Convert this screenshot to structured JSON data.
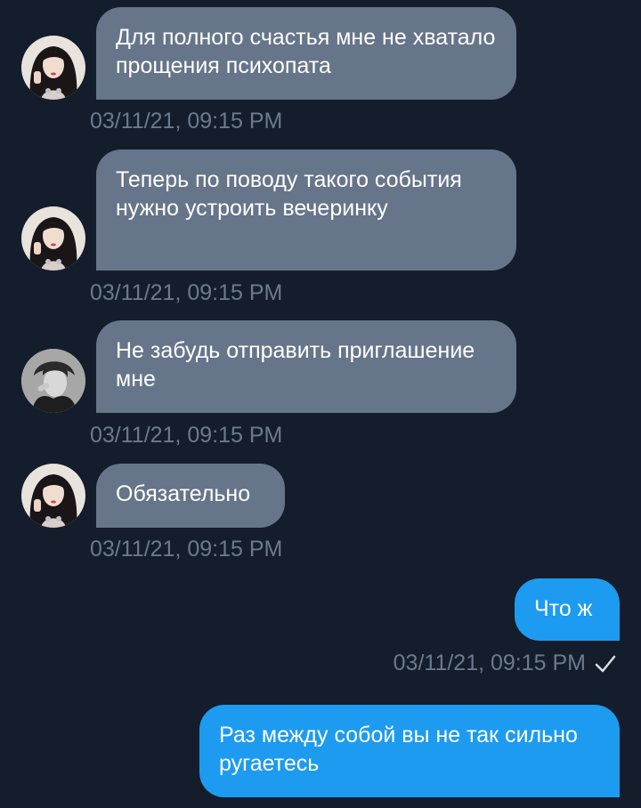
{
  "messages": [
    {
      "direction": "incoming",
      "avatar": "avatar-girl",
      "text": "Для полного счастья мне не хватало прощения психопата",
      "timestamp": "03/11/21, 09:15 PM"
    },
    {
      "direction": "incoming",
      "avatar": "avatar-girl",
      "text": "Теперь по поводу такого события нужно устроить вечеринку",
      "timestamp": "03/11/21, 09:15 PM"
    },
    {
      "direction": "incoming",
      "avatar": "avatar-guy",
      "text": "Не забудь отправить приглашение мне",
      "timestamp": "03/11/21, 09:15 PM"
    },
    {
      "direction": "incoming",
      "avatar": "avatar-girl",
      "text": "Обязательно",
      "timestamp": "03/11/21, 09:15 PM"
    },
    {
      "direction": "outgoing",
      "text": "Что ж",
      "timestamp": "03/11/21, 09:15 PM",
      "status_icon": "check-icon"
    },
    {
      "direction": "outgoing",
      "text": "Раз между собой вы не так сильно ругаетесь"
    }
  ],
  "colors": {
    "background": "#141D2B",
    "incoming_bubble": "#66758A",
    "outgoing_bubble": "#1C9BF0",
    "timestamp": "#6B7A8C",
    "text": "#FFFFFF"
  }
}
